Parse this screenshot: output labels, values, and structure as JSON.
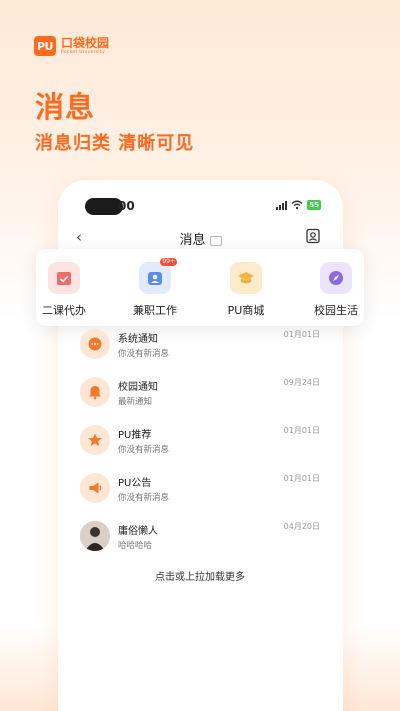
{
  "brand": {
    "mark": "PU",
    "name_cn": "口袋校园",
    "name_en": "Pocket University"
  },
  "headline": "消息",
  "subline": "消息归类  清晰可见",
  "status_bar": {
    "time": "00",
    "battery": "55"
  },
  "nav": {
    "title": "消息"
  },
  "categories": [
    {
      "label": "二课代办",
      "color": "#f26a6a",
      "bg": "#fde3e1"
    },
    {
      "label": "兼职工作",
      "color": "#5a8df0",
      "bg": "#e2ebfd",
      "badge": "99+"
    },
    {
      "label": "PU商城",
      "color": "#f5b23a",
      "bg": "#fdeccc"
    },
    {
      "label": "校园生活",
      "color": "#8a68e8",
      "bg": "#ece4fd"
    }
  ],
  "messages": [
    {
      "title": "系统通知",
      "subtitle": "你没有新消息",
      "date": "01月01日",
      "icon": "chat-icon"
    },
    {
      "title": "校园通知",
      "subtitle": "最新通知",
      "date": "09月24日",
      "icon": "bell-icon"
    },
    {
      "title": "PU推荐",
      "subtitle": "你没有新消息",
      "date": "01月01日",
      "icon": "star-icon"
    },
    {
      "title": "PU公告",
      "subtitle": "你没有新消息",
      "date": "01月01日",
      "icon": "megaphone-icon"
    },
    {
      "title": "庸俗懒人",
      "subtitle": "哈哈哈哈",
      "date": "04月20日",
      "icon": "user-avatar"
    }
  ],
  "load_more": "点击或上拉加载更多",
  "colors": {
    "accent": "#ff6a1f",
    "icon_orange": "#f47a2a"
  }
}
